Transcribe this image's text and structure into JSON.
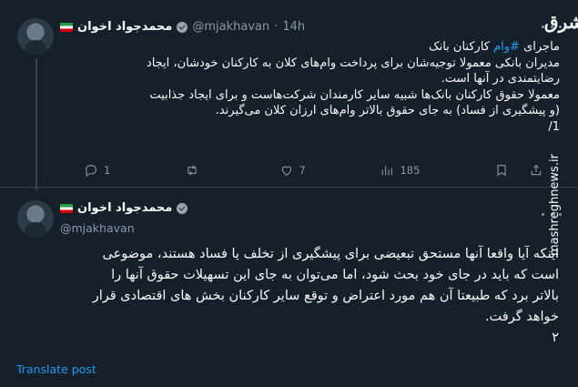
{
  "tweet1": {
    "author_name": "محمدجواد اخوان",
    "handle": "@mjakhavan",
    "separator": "·",
    "time": "14h",
    "lines": [
      {
        "before": "ماجرای ",
        "hashtag": "#وام",
        "after": " کارکنان بانک"
      },
      {
        "before": "مدیران بانکی معمولا توجیه‌شان برای پرداخت وام‌های کلان به کارکنان خودشان، ایجاد",
        "hashtag": "",
        "after": ""
      },
      {
        "before": "رضایتمندی در آنها است.",
        "hashtag": "",
        "after": ""
      },
      {
        "before": "معمولا حقوق کارکنان بانک‌ها شبیه سایر کارمندان شرکت‌هاست و برای ایجاد جذابیت",
        "hashtag": "",
        "after": ""
      },
      {
        "before": "(و پیشگیری از فساد) به جای حقوق بالاتر وام‌های ارزان کلان می‌گیرند.",
        "hashtag": "",
        "after": ""
      },
      {
        "before": "1/",
        "hashtag": "",
        "after": ""
      }
    ],
    "actions": {
      "replies": "1",
      "retweets": "",
      "likes": "7",
      "views": "185"
    }
  },
  "tweet2": {
    "author_name": "محمدجواد اخوان",
    "handle": "@mjakhavan",
    "lines": [
      "اینکه آیا واقعا آنها مستحق تبعیضی برای پیشگیری از تخلف یا فساد هستند، موضوعی",
      "است که باید در جای خود بحث شود، اما می‌توان به جای این تسهیلات حقوق آنها را",
      "بالاتر برد که طبیعتا آن هم مورد اعتراض و توقع سایر کارکنان بخش های اقتصادی قرار",
      "خواهد گرفت.",
      "۲"
    ],
    "translate_label": "Translate post"
  },
  "watermark": {
    "logo": "مشرق",
    "site": "mashreghnews.ir"
  },
  "icons": {
    "reply": "reply-icon",
    "retweet": "retweet-icon",
    "like": "heart-icon",
    "views": "views-icon",
    "bookmark": "bookmark-icon",
    "share": "share-icon",
    "more": "more-icon",
    "verified": "verified-badge-icon",
    "flag": "iran-flag-icon"
  },
  "colors": {
    "background": "#15202b",
    "text": "#f7f9f9",
    "muted": "#8b98a5",
    "accent": "#1d9bf0",
    "divider": "#38444d"
  }
}
